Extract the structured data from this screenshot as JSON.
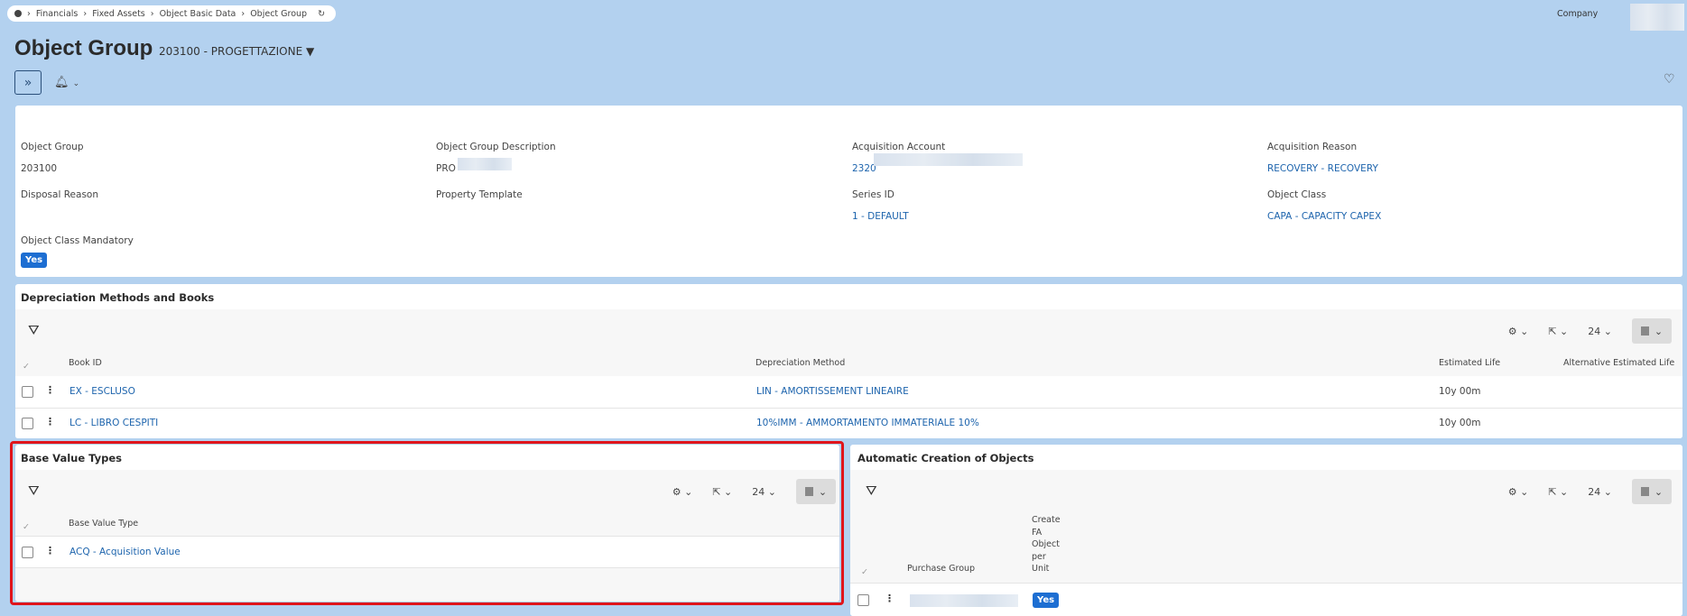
{
  "breadcrumb": [
    "Financials",
    "Fixed Assets",
    "Object Basic Data",
    "Object Group"
  ],
  "header": {
    "title": "Object Group",
    "subtitle": "203100 - PROGETTAZIONE",
    "company_label": "Company"
  },
  "fields": [
    {
      "label": "Object Group",
      "value": "203100",
      "type": "text"
    },
    {
      "label": "Object Group Description",
      "value": "PRO",
      "type": "text"
    },
    {
      "label": "Acquisition Account",
      "value": "2320",
      "type": "link"
    },
    {
      "label": "Acquisition Reason",
      "value": "RECOVERY - RECOVERY",
      "type": "link"
    },
    {
      "label": "Disposal Reason",
      "value": "",
      "type": "text"
    },
    {
      "label": "Property Template",
      "value": "",
      "type": "text"
    },
    {
      "label": "Series ID",
      "value": "1 - DEFAULT",
      "type": "link"
    },
    {
      "label": "Object Class",
      "value": "CAPA - CAPACITY CAPEX",
      "type": "link"
    },
    {
      "label": "Object Class Mandatory",
      "value": "Yes",
      "type": "badge"
    }
  ],
  "depreciation": {
    "title": "Depreciation Methods and Books",
    "page_size": "24",
    "columns": [
      "Book ID",
      "Depreciation Method",
      "Estimated Life",
      "Alternative Estimated Life"
    ],
    "rows": [
      [
        "EX - ESCLUSO",
        "LIN - AMORTISSEMENT LINEAIRE",
        "10y 00m",
        ""
      ],
      [
        "LC - LIBRO CESPITI",
        "10%IMM - AMMORTAMENTO IMMATERIALE 10%",
        "10y 00m",
        ""
      ]
    ]
  },
  "base_value": {
    "title": "Base Value Types",
    "page_size": "24",
    "columns": [
      "Base Value Type"
    ],
    "rows": [
      [
        "ACQ - Acquisition Value"
      ]
    ]
  },
  "auto_create": {
    "title": "Automatic Creation of Objects",
    "page_size": "24",
    "columns": [
      "Purchase Group",
      "Create FA Object per Unit"
    ],
    "rows": [
      [
        "",
        "Yes"
      ]
    ]
  },
  "colors": {
    "background": "#b3d1ef",
    "link": "#1d64ad",
    "badge": "#1d6ed2",
    "highlight": "#e0151b"
  }
}
